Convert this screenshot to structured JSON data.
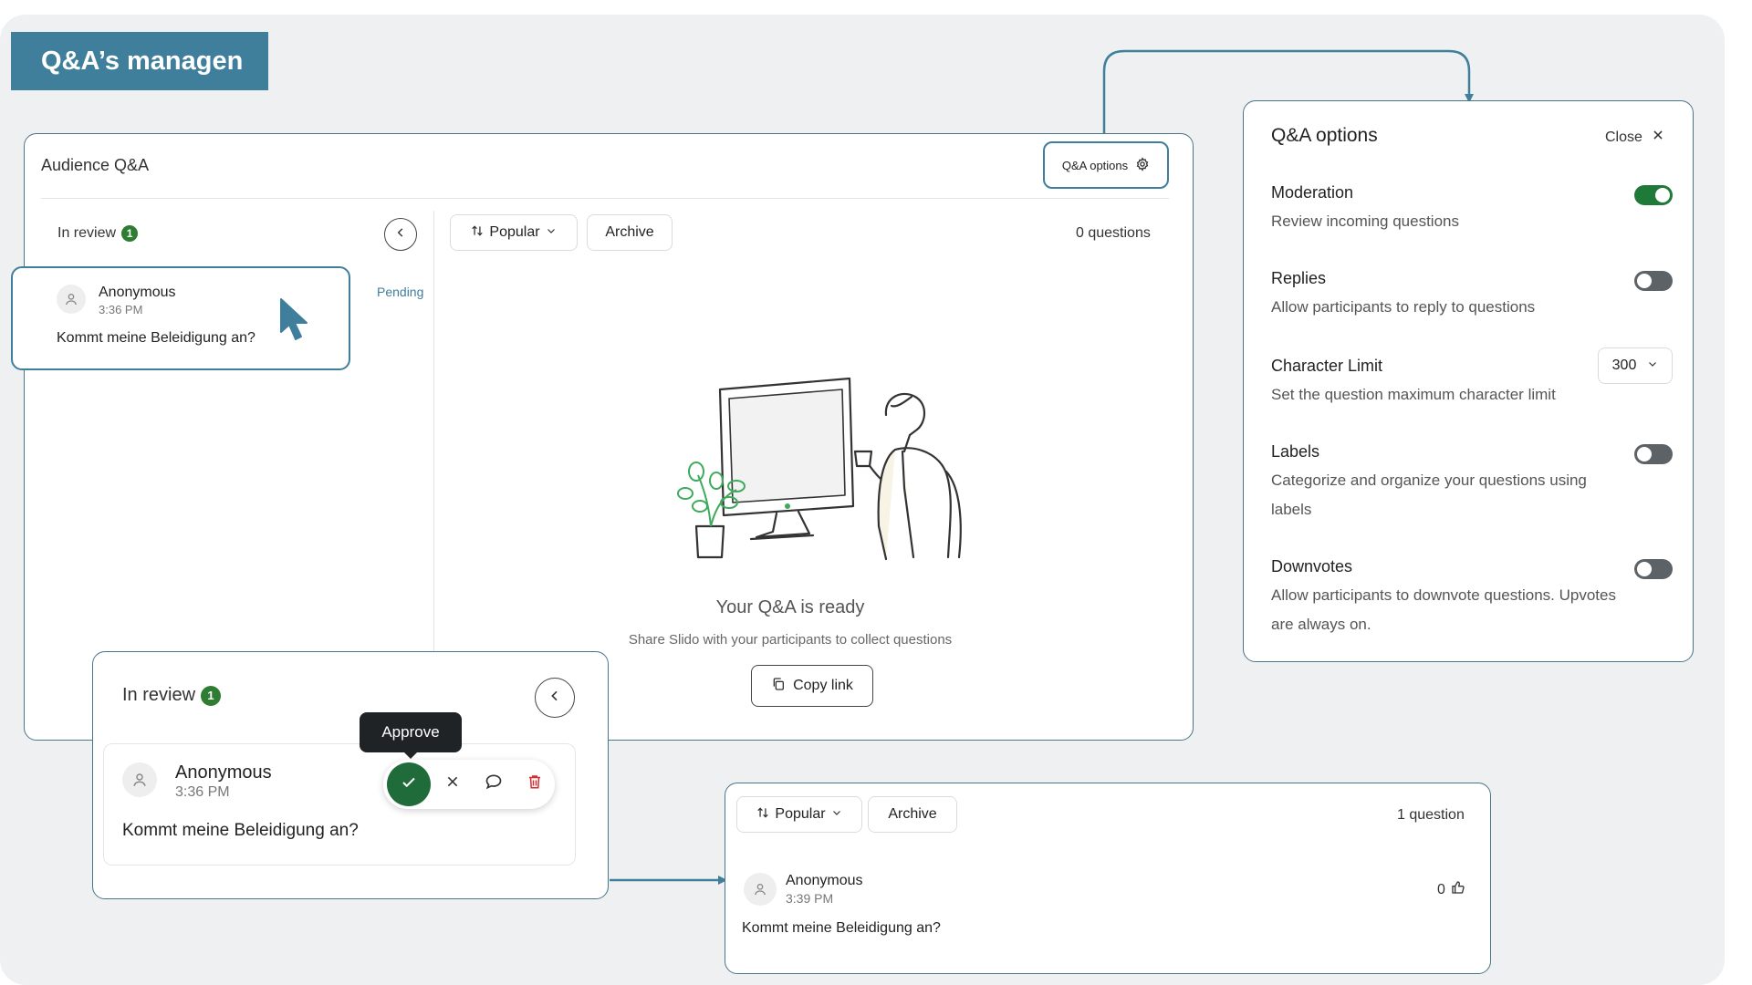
{
  "banner": {
    "title": "Q&A’s managen"
  },
  "main": {
    "title": "Audience Q&A",
    "options_button": "Q&A options",
    "review": {
      "label": "In review",
      "count": "1"
    },
    "filter": {
      "sort_label": "Popular",
      "archive_label": "Archive",
      "count_text": "0 questions"
    },
    "question": {
      "author": "Anonymous",
      "time": "3:36 PM",
      "text": "Kommt meine Beleidigung an?",
      "status": "Pending"
    },
    "empty_state": {
      "title": "Your Q&A is ready",
      "subtitle": "Share Slido with your participants to collect questions",
      "copy_button": "Copy link"
    }
  },
  "review_zoom": {
    "label": "In review",
    "count": "1",
    "tooltip": "Approve",
    "question": {
      "author": "Anonymous",
      "time": "3:36 PM",
      "text": "Kommt meine Beleidigung an?"
    }
  },
  "approved": {
    "sort_label": "Popular",
    "archive_label": "Archive",
    "count_text": "1 question",
    "question": {
      "author": "Anonymous",
      "time": "3:39 PM",
      "text": "Kommt meine Beleidigung an?",
      "votes": "0"
    }
  },
  "options_panel": {
    "title": "Q&A options",
    "close_label": "Close",
    "items": [
      {
        "label": "Moderation",
        "description": "Review incoming questions",
        "enabled": true
      },
      {
        "label": "Replies",
        "description": "Allow participants to reply to questions",
        "enabled": false
      },
      {
        "label": "Character Limit",
        "description": "Set the question maximum character limit",
        "value": "300"
      },
      {
        "label": "Labels",
        "description": "Categorize and organize your questions using labels",
        "enabled": false
      },
      {
        "label": "Downvotes",
        "description": "Allow participants to downvote questions. Upvotes are always on.",
        "enabled": false
      }
    ]
  },
  "colors": {
    "accent": "#3f7f9b",
    "approve": "#1f6b3a",
    "toggle_on": "#1f7a3a",
    "toggle_off": "#5d6266",
    "delete": "#d32f2f",
    "illustration_green": "#3daa5c"
  }
}
